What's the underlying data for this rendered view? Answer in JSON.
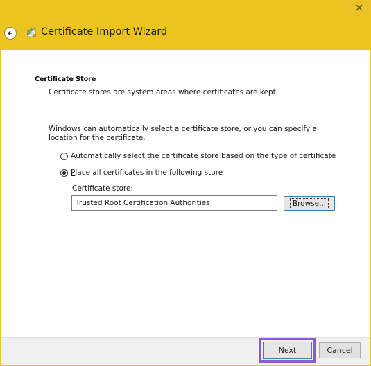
{
  "window": {
    "title": "Certificate Import Wizard"
  },
  "section": {
    "heading": "Certificate Store",
    "description": "Certificate stores are system areas where certificates are kept."
  },
  "info": {
    "text": "Windows can automatically select a certificate store, or you can specify a location for the certificate."
  },
  "options": {
    "auto": {
      "label_first": "A",
      "label_rest": "utomatically select the certificate store based on the type of certificate",
      "selected": false
    },
    "manual": {
      "label_first": "P",
      "label_rest": "lace all certificates in the following store",
      "selected": true
    }
  },
  "store": {
    "label": "Certificate store:",
    "value": "Trusted Root Certification Authorities",
    "browse_first": "B",
    "browse_rest": "rowse..."
  },
  "footer": {
    "next_first": "N",
    "next_rest": "ext",
    "cancel_label": "Cancel"
  },
  "colors": {
    "title_bar": "#ecc420",
    "highlight": "#8c5bd1"
  },
  "icons": {
    "close": "close-icon",
    "back": "back-arrow-icon",
    "wizard": "certificate-wizard-icon"
  }
}
